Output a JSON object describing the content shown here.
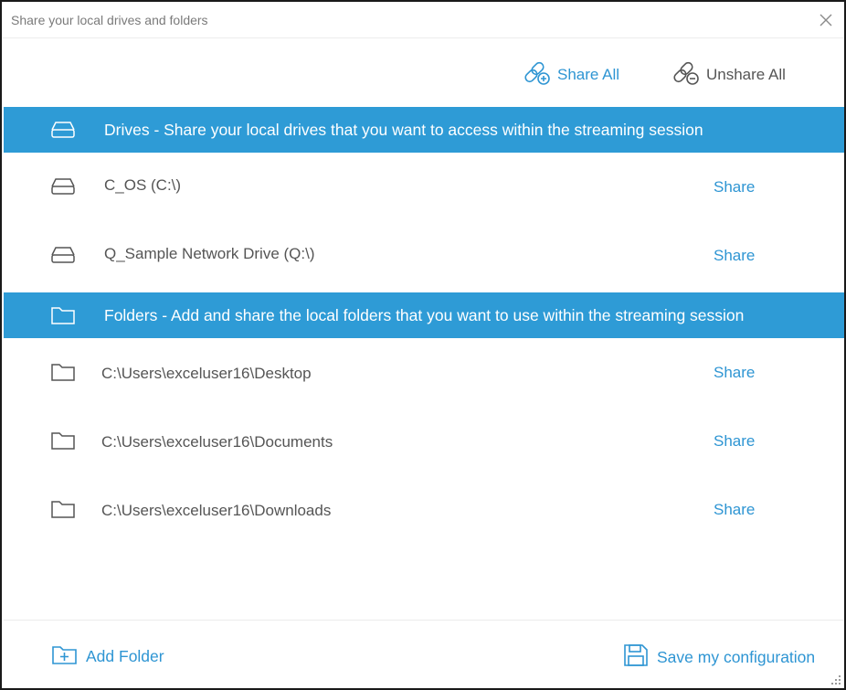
{
  "window": {
    "title": "Share your local drives and folders"
  },
  "toolbar": {
    "share_all_label": "Share All",
    "unshare_all_label": "Unshare All"
  },
  "drives_section": {
    "header": "Drives - Share your local drives that you want to access within the streaming session",
    "items": [
      {
        "label": "C_OS (C:\\)",
        "action": "Share"
      },
      {
        "label": "Q_Sample Network Drive (Q:\\)",
        "action": "Share"
      }
    ]
  },
  "folders_section": {
    "header": "Folders - Add and share the local folders that you want to use within the streaming session",
    "items": [
      {
        "label": "C:\\Users\\exceluser16\\Desktop",
        "action": "Share"
      },
      {
        "label": "C:\\Users\\exceluser16\\Documents",
        "action": "Share"
      },
      {
        "label": "C:\\Users\\exceluser16\\Downloads",
        "action": "Share"
      }
    ]
  },
  "footer": {
    "add_folder_label": "Add Folder",
    "save_config_label": "Save my configuration"
  },
  "colors": {
    "accent": "#2e9bd6",
    "link": "#2e95d3",
    "text": "#555555"
  }
}
